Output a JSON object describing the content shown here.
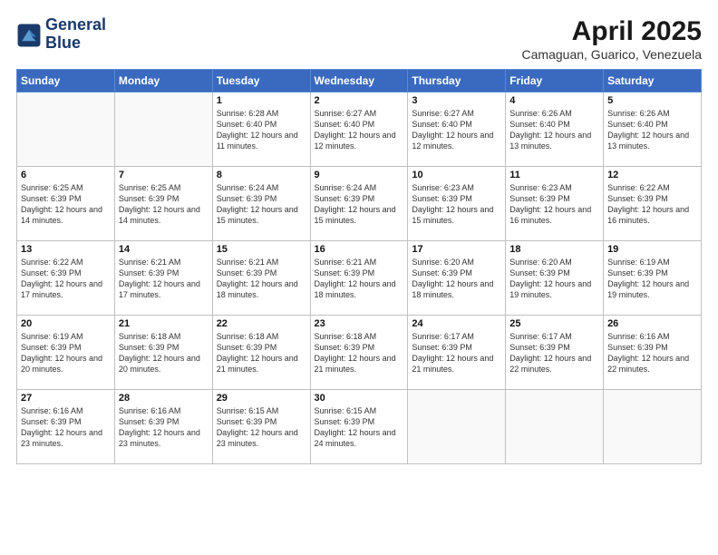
{
  "logo": {
    "line1": "General",
    "line2": "Blue"
  },
  "title": "April 2025",
  "subtitle": "Camaguan, Guarico, Venezuela",
  "days_of_week": [
    "Sunday",
    "Monday",
    "Tuesday",
    "Wednesday",
    "Thursday",
    "Friday",
    "Saturday"
  ],
  "weeks": [
    [
      {
        "day": "",
        "detail": ""
      },
      {
        "day": "",
        "detail": ""
      },
      {
        "day": "1",
        "detail": "Sunrise: 6:28 AM\nSunset: 6:40 PM\nDaylight: 12 hours and 11 minutes."
      },
      {
        "day": "2",
        "detail": "Sunrise: 6:27 AM\nSunset: 6:40 PM\nDaylight: 12 hours and 12 minutes."
      },
      {
        "day": "3",
        "detail": "Sunrise: 6:27 AM\nSunset: 6:40 PM\nDaylight: 12 hours and 12 minutes."
      },
      {
        "day": "4",
        "detail": "Sunrise: 6:26 AM\nSunset: 6:40 PM\nDaylight: 12 hours and 13 minutes."
      },
      {
        "day": "5",
        "detail": "Sunrise: 6:26 AM\nSunset: 6:40 PM\nDaylight: 12 hours and 13 minutes."
      }
    ],
    [
      {
        "day": "6",
        "detail": "Sunrise: 6:25 AM\nSunset: 6:39 PM\nDaylight: 12 hours and 14 minutes."
      },
      {
        "day": "7",
        "detail": "Sunrise: 6:25 AM\nSunset: 6:39 PM\nDaylight: 12 hours and 14 minutes."
      },
      {
        "day": "8",
        "detail": "Sunrise: 6:24 AM\nSunset: 6:39 PM\nDaylight: 12 hours and 15 minutes."
      },
      {
        "day": "9",
        "detail": "Sunrise: 6:24 AM\nSunset: 6:39 PM\nDaylight: 12 hours and 15 minutes."
      },
      {
        "day": "10",
        "detail": "Sunrise: 6:23 AM\nSunset: 6:39 PM\nDaylight: 12 hours and 15 minutes."
      },
      {
        "day": "11",
        "detail": "Sunrise: 6:23 AM\nSunset: 6:39 PM\nDaylight: 12 hours and 16 minutes."
      },
      {
        "day": "12",
        "detail": "Sunrise: 6:22 AM\nSunset: 6:39 PM\nDaylight: 12 hours and 16 minutes."
      }
    ],
    [
      {
        "day": "13",
        "detail": "Sunrise: 6:22 AM\nSunset: 6:39 PM\nDaylight: 12 hours and 17 minutes."
      },
      {
        "day": "14",
        "detail": "Sunrise: 6:21 AM\nSunset: 6:39 PM\nDaylight: 12 hours and 17 minutes."
      },
      {
        "day": "15",
        "detail": "Sunrise: 6:21 AM\nSunset: 6:39 PM\nDaylight: 12 hours and 18 minutes."
      },
      {
        "day": "16",
        "detail": "Sunrise: 6:21 AM\nSunset: 6:39 PM\nDaylight: 12 hours and 18 minutes."
      },
      {
        "day": "17",
        "detail": "Sunrise: 6:20 AM\nSunset: 6:39 PM\nDaylight: 12 hours and 18 minutes."
      },
      {
        "day": "18",
        "detail": "Sunrise: 6:20 AM\nSunset: 6:39 PM\nDaylight: 12 hours and 19 minutes."
      },
      {
        "day": "19",
        "detail": "Sunrise: 6:19 AM\nSunset: 6:39 PM\nDaylight: 12 hours and 19 minutes."
      }
    ],
    [
      {
        "day": "20",
        "detail": "Sunrise: 6:19 AM\nSunset: 6:39 PM\nDaylight: 12 hours and 20 minutes."
      },
      {
        "day": "21",
        "detail": "Sunrise: 6:18 AM\nSunset: 6:39 PM\nDaylight: 12 hours and 20 minutes."
      },
      {
        "day": "22",
        "detail": "Sunrise: 6:18 AM\nSunset: 6:39 PM\nDaylight: 12 hours and 21 minutes."
      },
      {
        "day": "23",
        "detail": "Sunrise: 6:18 AM\nSunset: 6:39 PM\nDaylight: 12 hours and 21 minutes."
      },
      {
        "day": "24",
        "detail": "Sunrise: 6:17 AM\nSunset: 6:39 PM\nDaylight: 12 hours and 21 minutes."
      },
      {
        "day": "25",
        "detail": "Sunrise: 6:17 AM\nSunset: 6:39 PM\nDaylight: 12 hours and 22 minutes."
      },
      {
        "day": "26",
        "detail": "Sunrise: 6:16 AM\nSunset: 6:39 PM\nDaylight: 12 hours and 22 minutes."
      }
    ],
    [
      {
        "day": "27",
        "detail": "Sunrise: 6:16 AM\nSunset: 6:39 PM\nDaylight: 12 hours and 23 minutes."
      },
      {
        "day": "28",
        "detail": "Sunrise: 6:16 AM\nSunset: 6:39 PM\nDaylight: 12 hours and 23 minutes."
      },
      {
        "day": "29",
        "detail": "Sunrise: 6:15 AM\nSunset: 6:39 PM\nDaylight: 12 hours and 23 minutes."
      },
      {
        "day": "30",
        "detail": "Sunrise: 6:15 AM\nSunset: 6:39 PM\nDaylight: 12 hours and 24 minutes."
      },
      {
        "day": "",
        "detail": ""
      },
      {
        "day": "",
        "detail": ""
      },
      {
        "day": "",
        "detail": ""
      }
    ]
  ]
}
